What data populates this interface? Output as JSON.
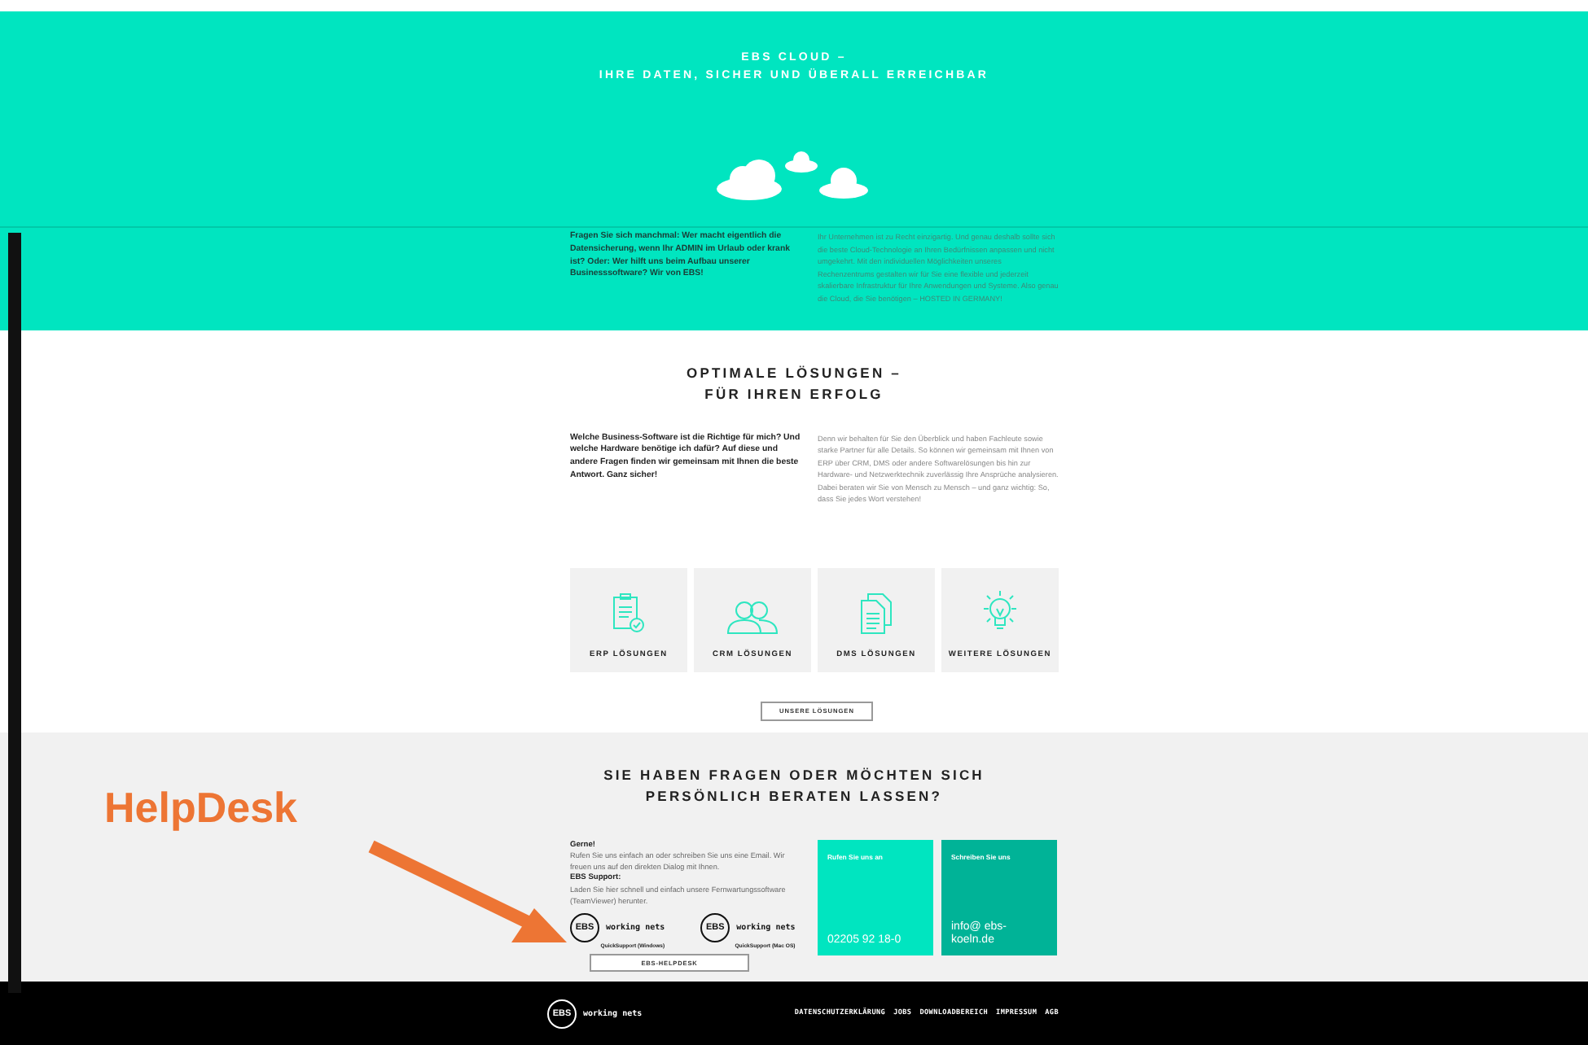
{
  "hero": {
    "title_lines": [
      "EBS CLOUD –",
      "IHRE DATEN, SICHER UND ÜBERALL ERREICHBAR"
    ],
    "intro": "Fragen Sie sich manchmal: Wer macht eigentlich die Datensicherung, wenn Ihr ADMIN im Urlaub oder krank ist? Oder: Wer hilft uns beim Aufbau unserer Businesssoftware? Wir von EBS!",
    "text": "Ihr Unternehmen ist zu Recht einzigartig. Und genau deshalb sollte sich die beste Cloud-Technologie an Ihren Bedürfnissen anpassen und nicht umgekehrt. Mit den individuellen Möglichkeiten unseres Rechenzentrums gestalten wir für Sie eine flexible und jederzeit skalierbare Infrastruktur für Ihre Anwendungen und Systeme. Also genau die Cloud, die Sie benötigen – HOSTED IN GERMANY!"
  },
  "solutions": {
    "title_lines": [
      "OPTIMALE LÖSUNGEN –",
      "FÜR IHREN ERFOLG"
    ],
    "intro": "Welche Business-Software ist die Richtige für mich? Und welche Hardware benötige ich dafür? Auf diese und andere Fragen finden wir gemeinsam mit Ihnen die beste Antwort. Ganz sicher!",
    "text": "Denn wir behalten für Sie den Überblick und haben Fachleute sowie starke Partner für alle Details. So können wir gemeinsam mit Ihnen von ERP über CRM, DMS oder andere Softwarelösungen bis hin zur Hardware- und Netzwerktechnik zuverlässig Ihre Ansprüche analysieren. Dabei beraten wir Sie von Mensch zu Mensch – und ganz wichtig: So, dass Sie jedes Wort verstehen!",
    "tiles": [
      {
        "label": "ERP LÖSUNGEN"
      },
      {
        "label": "CRM LÖSUNGEN"
      },
      {
        "label": "DMS LÖSUNGEN"
      },
      {
        "label": "WEITERE LÖSUNGEN"
      }
    ],
    "button": "UNSERE LÖSUNGEN"
  },
  "contact": {
    "title_lines": [
      "SIE HABEN FRAGEN ODER MÖCHTEN SICH",
      "PERSÖNLICH BERATEN LASSEN?"
    ],
    "gerne_title": "Gerne!",
    "gerne_text": "Rufen Sie uns einfach an oder schreiben Sie uns eine Email. Wir freuen uns auf den direkten Dialog mit Ihnen.",
    "support_title": "EBS Support:",
    "support_text": "Laden Sie hier schnell und einfach unsere Fernwartungssoftware (TeamViewer) herunter.",
    "downloads": [
      {
        "logo": "EBS",
        "brand": "working nets",
        "caption": "QuickSupport (Windows)"
      },
      {
        "logo": "EBS",
        "brand": "working nets",
        "caption": "QuickSupport (Mac OS)"
      }
    ],
    "button": "EBS-HELPDESK",
    "cards": [
      {
        "label": "Rufen Sie uns an",
        "value": "02205 92 18-0",
        "color": "#00e5c0"
      },
      {
        "label": "Schreiben Sie uns",
        "value": "info@ ebs-koeln.de",
        "color": "#00b397"
      }
    ]
  },
  "footer": {
    "logo": "EBS",
    "brand": "working nets",
    "links": [
      "DATENSCHUTZERKLÄRUNG",
      "JOBS",
      "DOWNLOADBEREICH",
      "IMPRESSUM",
      "AGB"
    ]
  },
  "annotation": {
    "label": "HelpDesk"
  }
}
